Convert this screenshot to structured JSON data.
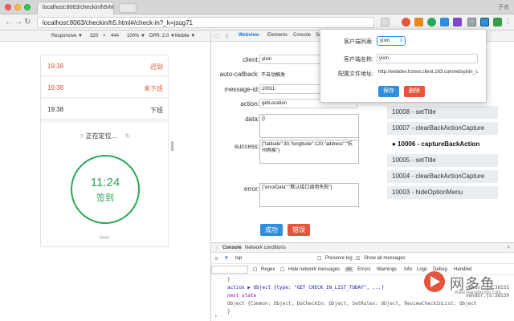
{
  "browser": {
    "tab_title": "localhost:8063/checkin/h5.ht",
    "tab_close": "×",
    "user": "子衣",
    "url": "localhost:8063/checkin/h5.html#/check-in?_k=jsug71"
  },
  "device_toolbar": {
    "preset": "Responsive ▼",
    "width": "320",
    "times": "×",
    "height": "444",
    "zoom": "100% ▼",
    "dpr": "DPR: 2.0 ▼",
    "mode": "Mobile ▼"
  },
  "phone": {
    "rows": [
      {
        "time": "19:38",
        "status": "迟到"
      },
      {
        "time": "19:38",
        "status": "未下班"
      },
      {
        "time": "19:38",
        "status": "下班"
      }
    ],
    "locating": "正在定位...",
    "clock_time": "11:24",
    "checkin_label": "签到"
  },
  "devtools_tabs": {
    "webview": "Webview",
    "elements": "Elements",
    "console": "Console",
    "sources": "Sc"
  },
  "form": {
    "client_label": "client:",
    "client_value": "yixin",
    "auto_callback_label": "auto-callback:",
    "auto_callback_value": "不自动触发",
    "message_id_label": "message-id:",
    "message_id_value": "10011",
    "action_label": "action:",
    "action_value": "getLocation",
    "data_label": "data:",
    "data_value": "{}",
    "success_label": "success:",
    "success_value": "{\"latitude\":30,\"longitude\":120,\"address\":\"杭州网易\"}",
    "error_label": "error:",
    "error_value": "{\"errorData\":\"默认接口调用失败\"}",
    "success_btn": "成功",
    "error_btn": "错误"
  },
  "call_list": [
    {
      "label": "10008 - setTitle",
      "active": false
    },
    {
      "label": "10007 - clearBackActionCapture",
      "active": false
    },
    {
      "label": "● 10006 - captureBackAction",
      "active": true
    },
    {
      "label": "10005 - setTitle",
      "active": false
    },
    {
      "label": "10004 - clearBackActionCapture",
      "active": false
    },
    {
      "label": "10003 - hideOptionMenu",
      "active": false
    }
  ],
  "popup": {
    "client_list_label": "客户端列表:",
    "client_list_value": "yixin",
    "client_name_label": "客户端名称:",
    "client_name_value": "yixin",
    "config_url_label": "配置文件地址:",
    "config_url_value": "http://webdev.hztest.client.163.com/wdsyixin_c",
    "save_btn": "保存",
    "delete_btn": "删除"
  },
  "console": {
    "tab_console": "Console",
    "tab_network": "Network conditions",
    "context": "top",
    "preserve_log": "Preserve log",
    "show_all": "Show all messages",
    "regex": "Regex",
    "hide_network": "Hide network messages",
    "levels": [
      "All",
      "Errors",
      "Warnings",
      "Info",
      "Logs",
      "Debug",
      "Handled"
    ],
    "lines": [
      {
        "text": "}",
        "cls": "dim"
      },
      {
        "text": "action ▶ Object {type: \"GET_CHECK_IN_LIST_TODAY\", ...}",
        "cls": "blue"
      },
      {
        "text": "next state",
        "cls": "purple"
      },
      {
        "text": "Object {Common: Object, DoCheckIn: Object, SetRules: Object, ReviewCheckInList: Object",
        "cls": "dim"
      },
      {
        "text": "}",
        "cls": "dim"
      }
    ],
    "src1": "vendor.js:36531",
    "src2": "vendor.js:36539",
    "prompt": "›"
  },
  "watermark": {
    "name": "网多鱼",
    "url": "www.wangduoyu.com"
  },
  "colors": {
    "accent_blue": "#2f8fde",
    "danger_red": "#e4553c",
    "success_green": "#2aa85a"
  }
}
